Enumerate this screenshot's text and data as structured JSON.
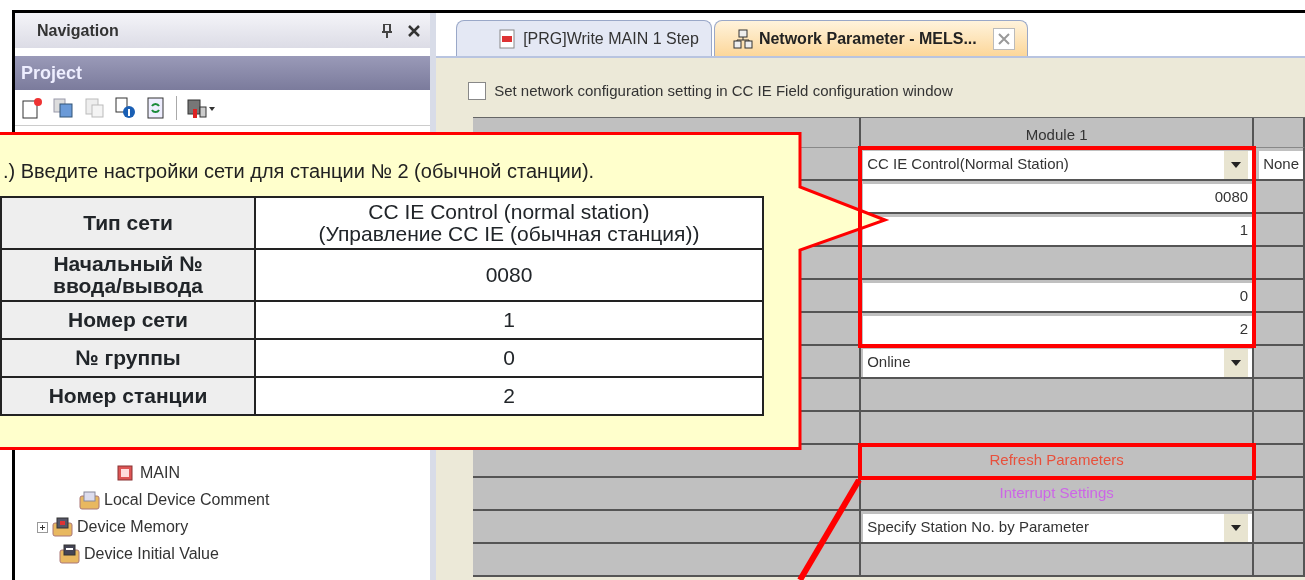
{
  "navigation": {
    "title": "Navigation",
    "section": "Project",
    "tree": [
      {
        "label": "MAIN",
        "kind": "program"
      },
      {
        "label": "Local Device Comment",
        "kind": "comment"
      },
      {
        "label": "Device Memory",
        "kind": "memory",
        "expanded": false
      },
      {
        "label": "Device Initial Value",
        "kind": "initial"
      }
    ]
  },
  "tabs": [
    {
      "label": "[PRG]Write MAIN 1 Step",
      "selected": false
    },
    {
      "label": "Network Parameter - MELS...",
      "selected": true
    }
  ],
  "config_checkbox": {
    "label": "Set network configuration setting in CC IE Field configuration window",
    "checked": false
  },
  "grid": {
    "columns": [
      "Module 1"
    ],
    "rows": [
      {
        "kind": "select",
        "value": "CC IE Control(Normal Station)",
        "next": "None",
        "highlighted": true
      },
      {
        "kind": "number",
        "value": "0080",
        "highlighted": true
      },
      {
        "kind": "number",
        "value": "1",
        "highlighted": true
      },
      {
        "kind": "blank",
        "highlighted": true
      },
      {
        "kind": "number",
        "value": "0",
        "highlighted": true
      },
      {
        "kind": "number",
        "value": "2",
        "highlighted": true
      },
      {
        "kind": "select",
        "value": "Online",
        "highlighted": false
      },
      {
        "kind": "blank",
        "highlighted": false
      },
      {
        "kind": "blank",
        "highlighted": false
      },
      {
        "kind": "link",
        "value": "Refresh Parameters",
        "color": "#e8503c",
        "highlighted": true
      },
      {
        "kind": "link",
        "value": "Interrupt Settings",
        "color": "#cc66e6",
        "highlighted": false
      },
      {
        "kind": "select",
        "value": "Specify Station No. by Parameter",
        "highlighted": false
      },
      {
        "kind": "blank",
        "highlighted": false
      }
    ]
  },
  "callout": {
    "text": ".) Введите настройки сети для станции № 2 (обычной станции).",
    "rows": [
      {
        "label": [
          "Тип сети"
        ],
        "value": [
          "CC IE Control (normal station)",
          "(Управление CC IE (обычная станция))"
        ]
      },
      {
        "label": [
          "Начальный №",
          "ввода/вывода"
        ],
        "value": [
          "0080"
        ]
      },
      {
        "label": [
          "Номер сети"
        ],
        "value": [
          "1"
        ]
      },
      {
        "label": [
          "№ группы"
        ],
        "value": [
          "0"
        ]
      },
      {
        "label": [
          "Номер станции"
        ],
        "value": [
          "2"
        ]
      }
    ]
  }
}
